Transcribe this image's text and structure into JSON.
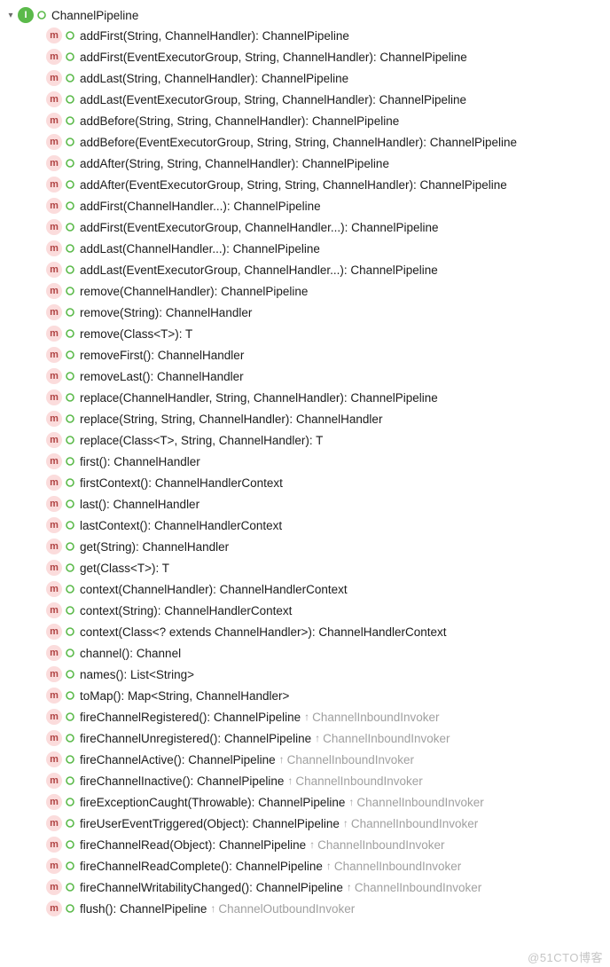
{
  "root": {
    "name": "ChannelPipeline",
    "expanded": true
  },
  "methods": [
    {
      "sig": "addFirst(String, ChannelHandler): ChannelPipeline"
    },
    {
      "sig": "addFirst(EventExecutorGroup, String, ChannelHandler): ChannelPipeline"
    },
    {
      "sig": "addLast(String, ChannelHandler): ChannelPipeline"
    },
    {
      "sig": "addLast(EventExecutorGroup, String, ChannelHandler): ChannelPipeline"
    },
    {
      "sig": "addBefore(String, String, ChannelHandler): ChannelPipeline"
    },
    {
      "sig": "addBefore(EventExecutorGroup, String, String, ChannelHandler): ChannelPipeline"
    },
    {
      "sig": "addAfter(String, String, ChannelHandler): ChannelPipeline"
    },
    {
      "sig": "addAfter(EventExecutorGroup, String, String, ChannelHandler): ChannelPipeline"
    },
    {
      "sig": "addFirst(ChannelHandler...): ChannelPipeline"
    },
    {
      "sig": "addFirst(EventExecutorGroup, ChannelHandler...): ChannelPipeline"
    },
    {
      "sig": "addLast(ChannelHandler...): ChannelPipeline"
    },
    {
      "sig": "addLast(EventExecutorGroup, ChannelHandler...): ChannelPipeline"
    },
    {
      "sig": "remove(ChannelHandler): ChannelPipeline"
    },
    {
      "sig": "remove(String): ChannelHandler"
    },
    {
      "sig": "remove(Class<T>): T"
    },
    {
      "sig": "removeFirst(): ChannelHandler"
    },
    {
      "sig": "removeLast(): ChannelHandler"
    },
    {
      "sig": "replace(ChannelHandler, String, ChannelHandler): ChannelPipeline"
    },
    {
      "sig": "replace(String, String, ChannelHandler): ChannelHandler"
    },
    {
      "sig": "replace(Class<T>, String, ChannelHandler): T"
    },
    {
      "sig": "first(): ChannelHandler"
    },
    {
      "sig": "firstContext(): ChannelHandlerContext"
    },
    {
      "sig": "last(): ChannelHandler"
    },
    {
      "sig": "lastContext(): ChannelHandlerContext"
    },
    {
      "sig": "get(String): ChannelHandler"
    },
    {
      "sig": "get(Class<T>): T"
    },
    {
      "sig": "context(ChannelHandler): ChannelHandlerContext"
    },
    {
      "sig": "context(String): ChannelHandlerContext"
    },
    {
      "sig": "context(Class<? extends ChannelHandler>): ChannelHandlerContext"
    },
    {
      "sig": "channel(): Channel"
    },
    {
      "sig": "names(): List<String>"
    },
    {
      "sig": "toMap(): Map<String, ChannelHandler>"
    },
    {
      "sig": "fireChannelRegistered(): ChannelPipeline",
      "from": "ChannelInboundInvoker"
    },
    {
      "sig": "fireChannelUnregistered(): ChannelPipeline",
      "from": "ChannelInboundInvoker"
    },
    {
      "sig": "fireChannelActive(): ChannelPipeline",
      "from": "ChannelInboundInvoker"
    },
    {
      "sig": "fireChannelInactive(): ChannelPipeline",
      "from": "ChannelInboundInvoker"
    },
    {
      "sig": "fireExceptionCaught(Throwable): ChannelPipeline",
      "from": "ChannelInboundInvoker"
    },
    {
      "sig": "fireUserEventTriggered(Object): ChannelPipeline",
      "from": "ChannelInboundInvoker"
    },
    {
      "sig": "fireChannelRead(Object): ChannelPipeline",
      "from": "ChannelInboundInvoker"
    },
    {
      "sig": "fireChannelReadComplete(): ChannelPipeline",
      "from": "ChannelInboundInvoker"
    },
    {
      "sig": "fireChannelWritabilityChanged(): ChannelPipeline",
      "from": "ChannelInboundInvoker"
    },
    {
      "sig": "flush(): ChannelPipeline",
      "from": "ChannelOutboundInvoker"
    }
  ],
  "watermark": "@51CTO博客"
}
